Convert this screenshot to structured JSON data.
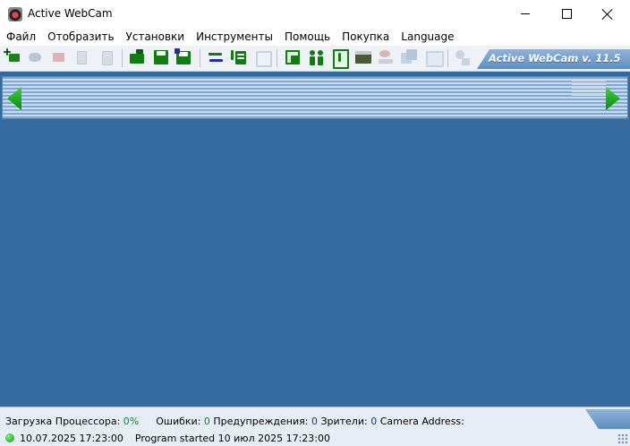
{
  "window": {
    "title": "Active WebCam"
  },
  "menu": {
    "items": [
      "Файл",
      "Отобразить",
      "Установки",
      "Инструменты",
      "Помощь",
      "Покупка",
      "Language"
    ]
  },
  "toolbar": {
    "brand_text": "Active WebCam v. 11.5",
    "buttons": [
      {
        "name": "add-camera-icon",
        "enabled": true
      },
      {
        "name": "camera-settings-icon",
        "enabled": false
      },
      {
        "name": "delete-camera-icon",
        "enabled": false
      },
      {
        "name": "copy-icon",
        "enabled": false
      },
      {
        "name": "paste-icon",
        "enabled": false
      },
      {
        "name": "open-folder-icon",
        "enabled": true
      },
      {
        "name": "save-icon",
        "enabled": true
      },
      {
        "name": "save-as-icon",
        "enabled": true
      },
      {
        "name": "switch-icon",
        "enabled": true
      },
      {
        "name": "log-list-icon",
        "enabled": true
      },
      {
        "name": "fullscreen-icon",
        "enabled": false
      },
      {
        "name": "checklist-icon",
        "enabled": true
      },
      {
        "name": "users-icon",
        "enabled": true
      },
      {
        "name": "single-view-icon",
        "enabled": true
      },
      {
        "name": "www-icon",
        "enabled": true
      },
      {
        "name": "record-icon",
        "enabled": false
      },
      {
        "name": "multi-view-icon",
        "enabled": false
      },
      {
        "name": "snapshot-icon",
        "enabled": false
      },
      {
        "name": "network-icon",
        "enabled": false
      }
    ]
  },
  "status": {
    "cpu_label": "Загрузка Процессора:",
    "cpu_value": "0%",
    "errors_label": "Ошибки:",
    "errors_value": "0",
    "warnings_label": "Предупреждения:",
    "warnings_value": "0",
    "viewers_label": "Зрители:",
    "viewers_value": "0",
    "camera_address_label": "Camera Address:",
    "log_time": "10.07.2025 17:23:00",
    "log_message": "Program started  10 июл 2025 17:23:00"
  }
}
